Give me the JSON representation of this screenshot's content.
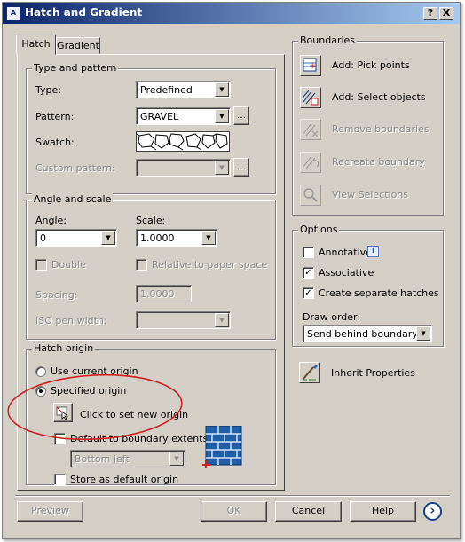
{
  "window": {
    "title": "Hatch and Gradient",
    "help_glyph": "?",
    "close_glyph": "X",
    "icon_text": "A"
  },
  "tabs": [
    {
      "label": "Hatch"
    },
    {
      "label": "Gradient"
    }
  ],
  "type_and_pattern": {
    "title": "Type and pattern",
    "type_label": "Type:",
    "type_value": "Predefined",
    "pattern_label": "Pattern:",
    "pattern_value": "GRAVEL",
    "pattern_browse": "...",
    "swatch_label": "Swatch:",
    "custom_pattern_label": "Custom pattern:",
    "custom_pattern_value": "",
    "custom_browse": "..."
  },
  "angle_and_scale": {
    "title": "Angle and scale",
    "angle_label": "Angle:",
    "angle_value": "0",
    "scale_label": "Scale:",
    "scale_value": "1.0000",
    "double_label": "Double",
    "relative_label": "Relative to paper space",
    "spacing_label": "Spacing:",
    "spacing_value": "1.0000",
    "iso_pen_label": "ISO pen width:",
    "iso_pen_value": ""
  },
  "hatch_origin": {
    "title": "Hatch origin",
    "use_current_label": "Use current origin",
    "specified_label": "Specified origin",
    "set_new_label": "Click to set new origin",
    "default_boundary_label": "Default to boundary extents",
    "boundary_position_value": "Bottom left",
    "store_default_label": "Store as default origin"
  },
  "boundaries": {
    "title": "Boundaries",
    "items": [
      {
        "label": "Add: Pick points",
        "enabled": true
      },
      {
        "label": "Add: Select objects",
        "enabled": true
      },
      {
        "label": "Remove boundaries",
        "enabled": false
      },
      {
        "label": "Recreate boundary",
        "enabled": false
      },
      {
        "label": "View Selections",
        "enabled": false
      }
    ]
  },
  "options": {
    "title": "Options",
    "annotative_label": "Annotative",
    "annotative_info": "i",
    "annotative_checked": false,
    "associative_label": "Associative",
    "associative_checked": true,
    "separate_label": "Create separate hatches",
    "separate_checked": true,
    "draw_order_label": "Draw order:",
    "draw_order_value": "Send behind boundary"
  },
  "inherit_properties_label": "Inherit Properties",
  "footer": {
    "preview": "Preview",
    "ok": "OK",
    "cancel": "Cancel",
    "help": "Help",
    "more_glyph": "›"
  },
  "colors": {
    "titlebar_start": "#0a246a",
    "titlebar_end": "#a6caf0",
    "face": "#d4d0c8",
    "annotation_ellipse": "#d42020",
    "origin_icon_blue": "#2a6cb8"
  }
}
